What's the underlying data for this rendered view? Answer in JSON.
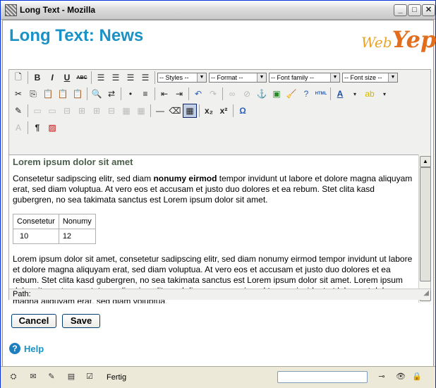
{
  "window": {
    "title": "Long Text - Mozilla",
    "minimize": "_",
    "maximize": "□",
    "close": "✕"
  },
  "page": {
    "title": "Long Text: News"
  },
  "logo": {
    "web": "Web",
    "yep": "Yep!"
  },
  "toolbar": {
    "styles": "-- Styles --",
    "format": "-- Format --",
    "font_family": "-- Font family --",
    "font_size": "-- Font size --",
    "bold": "B",
    "italic": "I",
    "underline": "U",
    "strike": "ABC",
    "html": "HTML",
    "sub": "x₂",
    "sup": "x²",
    "omega": "Ω",
    "pilcrow": "¶"
  },
  "content": {
    "heading": "Lorem ipsum dolor sit amet",
    "para1_a": "Consetetur sadipscing elitr, sed diam ",
    "para1_bold": "nonumy eirmod",
    "para1_b": " tempor invidunt ut labore et dolore magna aliquyam erat, sed diam voluptua. At vero eos et accusam et justo duo dolores et ea rebum. Stet clita kasd gubergren, no sea takimata sanctus est Lorem ipsum dolor sit amet.",
    "table": [
      [
        "Consetetur",
        "Nonumy"
      ],
      [
        "10",
        "12"
      ]
    ],
    "para2": "Lorem ipsum dolor sit amet, consetetur sadipscing elitr, sed diam nonumy eirmod tempor invidunt ut labore et dolore magna aliquyam erat, sed diam voluptua. At vero eos et accusam et justo duo dolores et ea rebum. Stet clita kasd gubergren, no sea takimata sanctus est Lorem ipsum dolor sit amet. Lorem ipsum dolor sit amet, consetetur sadipscing elitr, sed diam nonumy eirmod tempor invidunt ut labore et dolore magna aliquyam erat, sed diam voluptua."
  },
  "path": {
    "label": "Path:"
  },
  "buttons": {
    "cancel": "Cancel",
    "save": "Save"
  },
  "help": {
    "label": "Help",
    "icon": "?"
  },
  "status": {
    "text": "Fertig"
  }
}
